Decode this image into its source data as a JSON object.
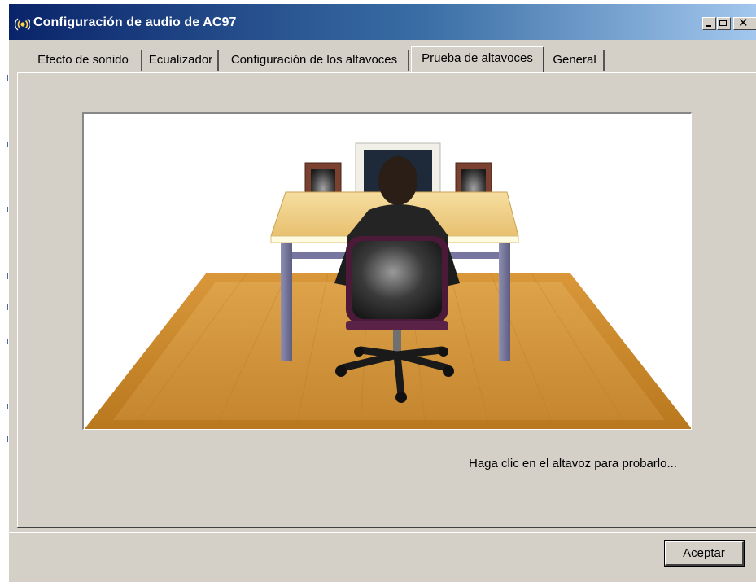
{
  "window": {
    "title": "Configuración de audio de AC97",
    "icon": "speaker-waves-icon"
  },
  "tabs": [
    {
      "label": "Efecto de sonido",
      "active": false
    },
    {
      "label": "Ecualizador",
      "active": false
    },
    {
      "label": "Configuración de los altavoces",
      "active": false
    },
    {
      "label": "Prueba de altavoces",
      "active": true
    },
    {
      "label": "General",
      "active": false
    }
  ],
  "panel": {
    "hint": "Haga clic en el altavoz para probarlo..."
  },
  "footer": {
    "ok_label": "Aceptar"
  },
  "colors": {
    "title_gradient_start": "#0a246a",
    "title_gradient_end": "#a6caf0",
    "dialog_face": "#d4d0c8",
    "floor": "#c98a2a",
    "desk_top": "#f2d38a",
    "speaker": "#7a4030"
  }
}
